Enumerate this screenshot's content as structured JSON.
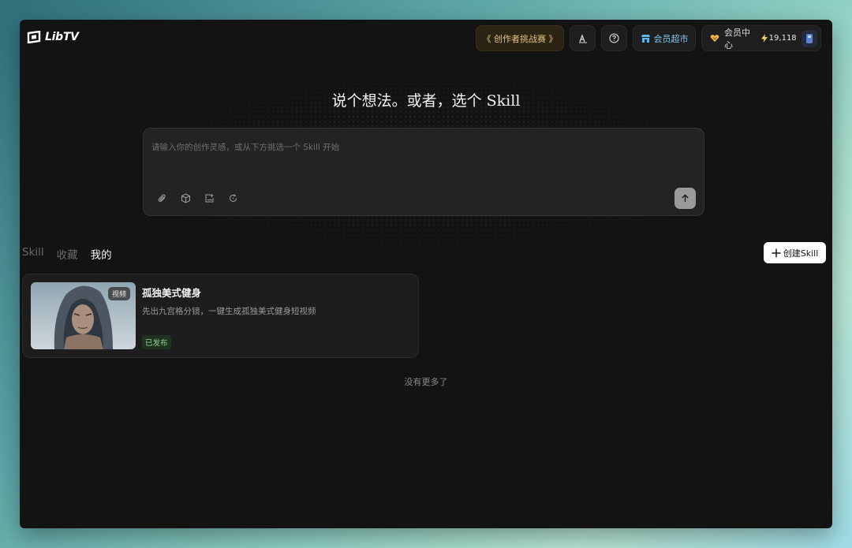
{
  "app": {
    "name": "LibTV"
  },
  "topbar": {
    "contest_label": "《 创作者挑战赛 》",
    "shop_label": "会员超市",
    "member_label": "会员中心",
    "credits": "19,118",
    "icons": {
      "font": "font-size-icon",
      "help": "help-circle-icon"
    }
  },
  "main": {
    "headline": "说个想法。或者，选个 Skill",
    "prompt_placeholder": "请输入你的创作灵感，或从下方挑选一个 Skill 开始",
    "prompt_value": ""
  },
  "tabs": [
    {
      "label": "Skill",
      "active": false
    },
    {
      "label": "收藏",
      "active": false
    },
    {
      "label": "我的",
      "active": true
    }
  ],
  "create_button": "创建Skill",
  "cards": [
    {
      "badge": "视频",
      "title": "孤独美式健身",
      "description": "先出九宫格分镜，一键生成孤独美式健身短视频",
      "status": "已发布"
    }
  ],
  "end_text": "没有更多了",
  "colors": {
    "accent_gold": "#e7c27a",
    "shop_blue": "#7fc6f0",
    "published_green": "#8fd28c"
  }
}
